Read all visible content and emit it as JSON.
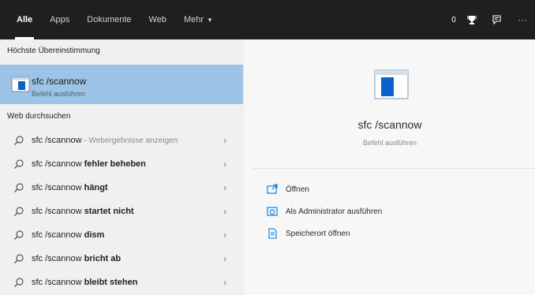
{
  "topbar": {
    "tabs": [
      {
        "label": "Alle"
      },
      {
        "label": "Apps"
      },
      {
        "label": "Dokumente"
      },
      {
        "label": "Web"
      },
      {
        "label": "Mehr"
      }
    ],
    "score": "0"
  },
  "left": {
    "best_match_title": "Höchste Übereinstimmung",
    "best_match": {
      "title": "sfc /scannow",
      "subtitle": "Befehl ausführen"
    },
    "web_title": "Web durchsuchen",
    "suggestions": [
      {
        "prefix": "sfc /scannow",
        "bold": "",
        "hint": " - Webergebnisse anzeigen"
      },
      {
        "prefix": "sfc /scannow ",
        "bold": "fehler beheben",
        "hint": ""
      },
      {
        "prefix": "sfc /scannow ",
        "bold": "hängt",
        "hint": ""
      },
      {
        "prefix": "sfc /scannow ",
        "bold": "startet nicht",
        "hint": ""
      },
      {
        "prefix": "sfc /scannow ",
        "bold": "dism",
        "hint": ""
      },
      {
        "prefix": "sfc /scannow ",
        "bold": "bricht ab",
        "hint": ""
      },
      {
        "prefix": "sfc /scannow ",
        "bold": "bleibt stehen",
        "hint": ""
      }
    ]
  },
  "preview": {
    "title": "sfc /scannow",
    "subtitle": "Befehl ausführen",
    "actions": [
      {
        "label": "Öffnen",
        "icon": "open-icon"
      },
      {
        "label": "Als Administrator ausführen",
        "icon": "run-as-admin-icon"
      },
      {
        "label": "Speicherort öffnen",
        "icon": "file-location-icon"
      }
    ]
  },
  "colors": {
    "topbar": "#1f1f1f",
    "selected": "#9dc4e6",
    "accent": "#0078d7"
  }
}
